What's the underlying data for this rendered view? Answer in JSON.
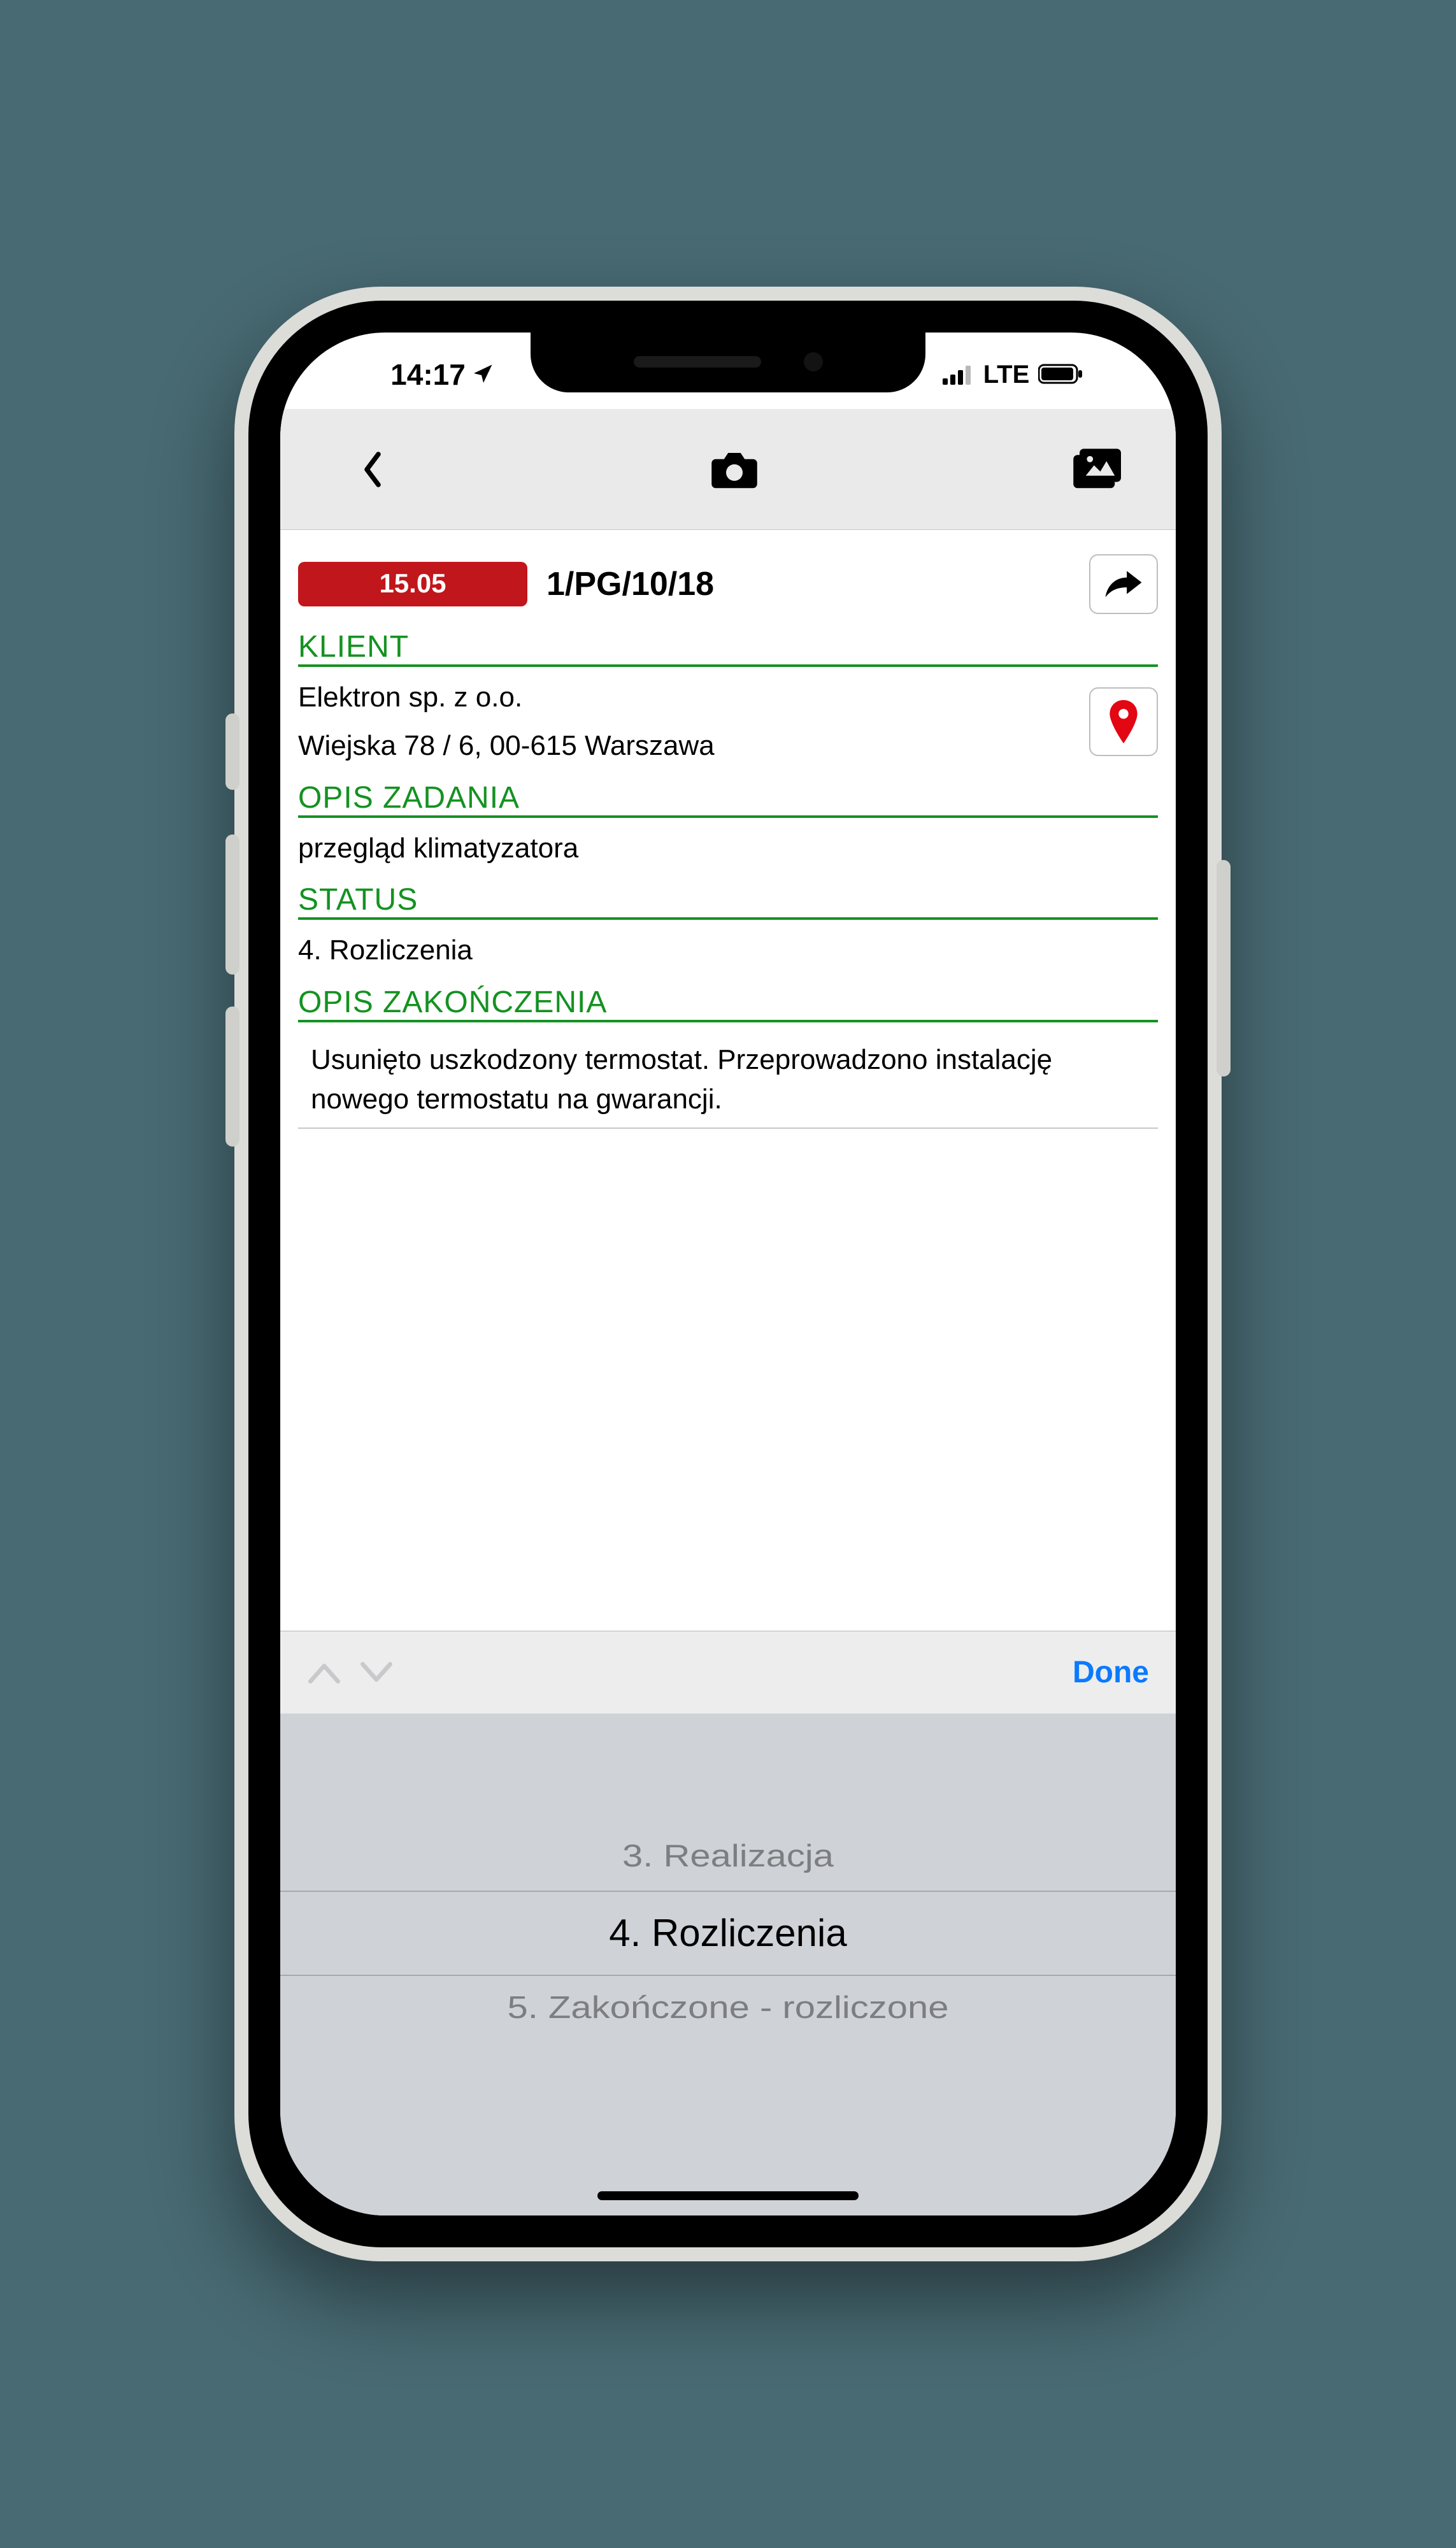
{
  "status_bar": {
    "time": "14:17",
    "network": "LTE"
  },
  "header": {
    "date": "15.05",
    "task_id": "1/PG/10/18"
  },
  "sections": {
    "klient": {
      "title": "KLIENT",
      "name": "Elektron sp. z o.o.",
      "address": "Wiejska 78 / 6, 00-615 Warszawa"
    },
    "opis_zadania": {
      "title": "OPIS ZADANIA",
      "text": "przegląd klimatyzatora"
    },
    "status": {
      "title": "STATUS",
      "value": "4. Rozliczenia"
    },
    "opis_zakonczenia": {
      "title": "OPIS ZAKOŃCZENIA",
      "text": "Usunięto uszkodzony termostat. Przeprowadzono instalację nowego termostatu na gwarancji."
    }
  },
  "kb_accessory": {
    "done": "Done"
  },
  "picker": {
    "options": [
      "3. Realizacja",
      "4. Rozliczenia",
      "5. Zakończone - rozliczone"
    ],
    "selected_index": 1
  }
}
